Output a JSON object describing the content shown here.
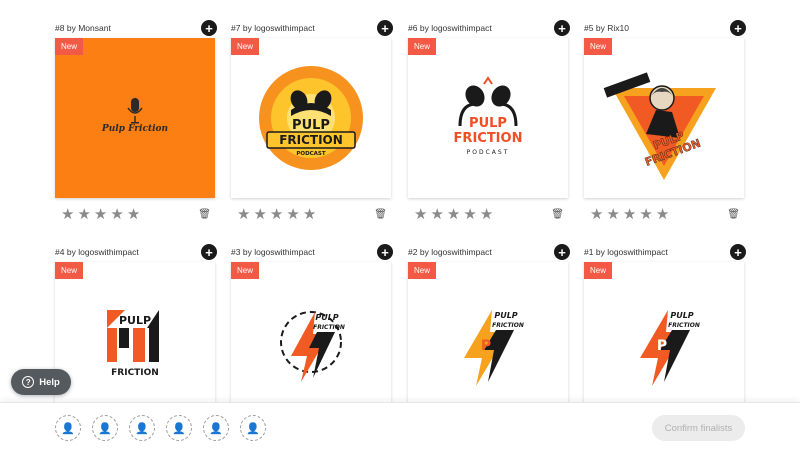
{
  "badge_label": "New",
  "icons": {
    "add": "plus-icon",
    "star": "star-icon",
    "delete": "trash-icon",
    "help": "question-icon",
    "person": "person-icon"
  },
  "colors": {
    "accent_orange": "#fb7f12",
    "badge_red": "#f25a45",
    "dark": "#1a1a1a"
  },
  "entries": [
    {
      "number": "#8",
      "by": "by",
      "designer": "Monsant",
      "logo_text": "Pulp Friction"
    },
    {
      "number": "#7",
      "by": "by",
      "designer": "logoswithimpact",
      "logo_text_1": "PULP",
      "logo_text_2": "FRICTION",
      "logo_text_3": "PODCAST"
    },
    {
      "number": "#6",
      "by": "by",
      "designer": "logoswithimpact",
      "logo_text_1": "PULP",
      "logo_text_2": "FRICTION",
      "logo_text_3": "PODCAST"
    },
    {
      "number": "#5",
      "by": "by",
      "designer": "Rix10",
      "logo_text_1": "PULP",
      "logo_text_2": "FRICTION"
    },
    {
      "number": "#4",
      "by": "by",
      "designer": "logoswithimpact",
      "logo_text_1": "PULP",
      "logo_text_2": "FRICTION"
    },
    {
      "number": "#3",
      "by": "by",
      "designer": "logoswithimpact",
      "logo_text_1": "PULP",
      "logo_text_2": "FRICTION"
    },
    {
      "number": "#2",
      "by": "by",
      "designer": "logoswithimpact",
      "logo_text_1": "PULP",
      "logo_text_2": "FRICTION"
    },
    {
      "number": "#1",
      "by": "by",
      "designer": "logoswithimpact",
      "logo_text_1": "PULP",
      "logo_text_2": "FRICTION"
    }
  ],
  "help_label": "Help",
  "confirm_label": "Confirm finalists",
  "finalist_slots": 6
}
